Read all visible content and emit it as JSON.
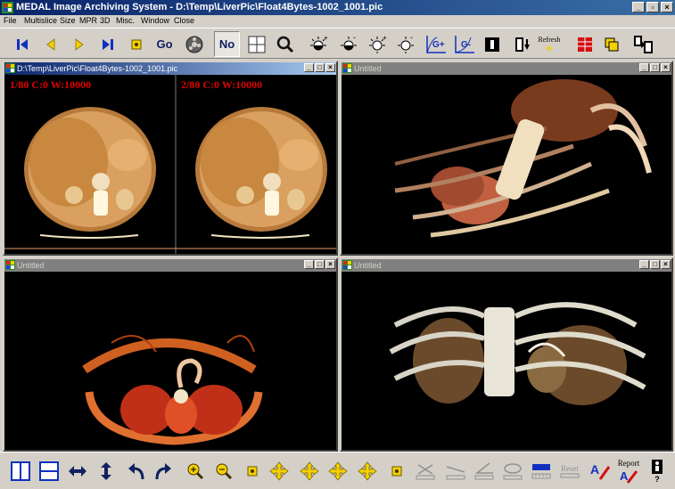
{
  "window": {
    "title": "MEDAL Image Archiving System - D:\\Temp\\LiverPic\\Float4Bytes-1002_1001.pic",
    "controls": [
      "_",
      "▫",
      "×"
    ]
  },
  "menu": [
    "File",
    "Multislice",
    "Size",
    "MPR",
    "3D",
    "Misc.",
    "Window",
    "Close"
  ],
  "toolbar": {
    "go_label": "Go",
    "no_label": "No",
    "refresh_label": "Refresh",
    "gamma_plus": "G+",
    "gamma_minus": "G-"
  },
  "panels": [
    {
      "title": "D:\\Temp\\LiverPic\\Float4Bytes-1002_1001.pic",
      "state": "active",
      "overlays": [
        "1/80 C:0 W:10000",
        "2/80 C:0 W:10000"
      ]
    },
    {
      "title": "Untitled",
      "state": "inactive"
    },
    {
      "title": "Untitled",
      "state": "inactive"
    },
    {
      "title": "Untitled",
      "state": "inactive"
    }
  ],
  "bottom": {
    "reset_label": "Reset",
    "report_label": "Report",
    "help_label": "?"
  },
  "colors": {
    "overlay_text": "#e00000",
    "active_title": "#0a246a",
    "inactive_title": "#808080",
    "toolbar_icon_yellow": "#f5d000",
    "toolbar_icon_blue": "#1030c0"
  }
}
